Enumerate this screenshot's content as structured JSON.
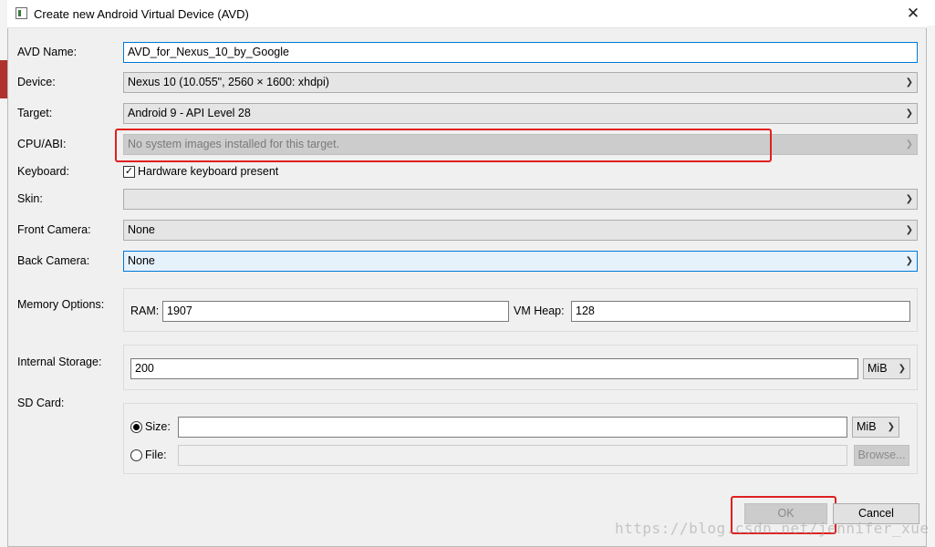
{
  "window": {
    "title": "Create new Android Virtual Device (AVD)",
    "close_symbol": "✕"
  },
  "fields": {
    "avd_name": {
      "label": "AVD Name:",
      "value": "AVD_for_Nexus_10_by_Google"
    },
    "device": {
      "label": "Device:",
      "value": "Nexus 10 (10.055\", 2560 × 1600: xhdpi)"
    },
    "target": {
      "label": "Target:",
      "value": "Android 9 - API Level 28"
    },
    "cpu_abi": {
      "label": "CPU/ABI:",
      "value": "No system images installed for this target."
    },
    "keyboard": {
      "label": "Keyboard:",
      "checkbox_label": "Hardware keyboard present",
      "checked": true
    },
    "skin": {
      "label": "Skin:",
      "value": ""
    },
    "front_camera": {
      "label": "Front Camera:",
      "value": "None"
    },
    "back_camera": {
      "label": "Back Camera:",
      "value": "None"
    }
  },
  "memory": {
    "label": "Memory Options:",
    "ram_label": "RAM:",
    "ram_value": "1907",
    "vm_heap_label": "VM Heap:",
    "vm_heap_value": "128"
  },
  "storage": {
    "label": "Internal Storage:",
    "value": "200",
    "unit": "MiB"
  },
  "sd_card": {
    "label": "SD Card:",
    "size_label": "Size:",
    "size_value": "",
    "size_unit": "MiB",
    "size_selected": true,
    "file_label": "File:",
    "file_value": "",
    "browse_label": "Browse..."
  },
  "buttons": {
    "ok": "OK",
    "cancel": "Cancel"
  },
  "watermark": "https://blog.csdn.net/jennifer_xue",
  "colors": {
    "highlight": "#e02020",
    "focus_border": "#0078d7"
  }
}
